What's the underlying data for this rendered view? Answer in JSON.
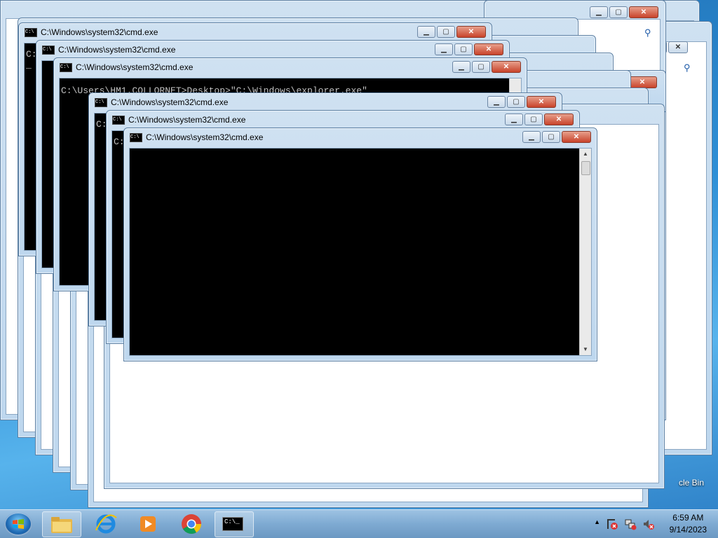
{
  "windows": [
    {
      "title": "C:\\Windows\\system32\\cmd.exe"
    },
    {
      "title": "C:\\Windows\\system32\\cmd.exe"
    },
    {
      "title": "C:\\Windows\\system32\\cmd.exe"
    },
    {
      "title": "C:\\Windows\\system32\\cmd.exe"
    },
    {
      "title": "C:\\Windows\\system32\\cmd.exe"
    },
    {
      "title": "C:\\Windows\\system32\\cmd.exe"
    }
  ],
  "console": {
    "prompt_line": "C:\\Users\\HM1.COLLORNET>Desktop>\"C:\\Windows\\explorer.exe\"",
    "stub": "C:",
    "cursor": "_"
  },
  "taskbar": {
    "cmd_icon_text": "C:\\_",
    "clock_time": "6:59 AM",
    "clock_date": "9/14/2023"
  },
  "desktop": {
    "recycle_bin_label": "cle Bin"
  },
  "colors": {
    "accent": "#3a7bd5",
    "close": "#c8432a"
  }
}
